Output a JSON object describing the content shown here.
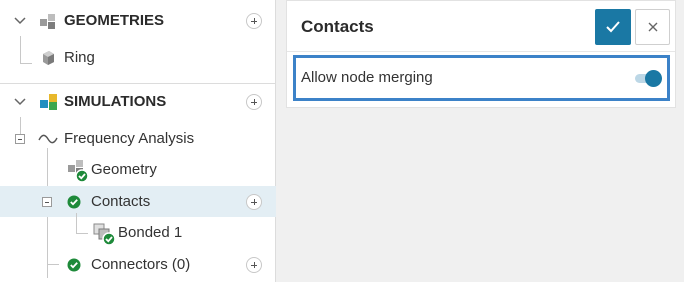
{
  "tree": {
    "geometries": {
      "label": "GEOMETRIES",
      "children": [
        {
          "label": "Ring"
        }
      ]
    },
    "simulations": {
      "label": "SIMULATIONS",
      "analysis": {
        "label": "Frequency Analysis",
        "items": [
          {
            "label": "Geometry",
            "status": "ok"
          },
          {
            "label": "Contacts",
            "status": "ok",
            "selected": true,
            "children": [
              {
                "label": "Bonded 1",
                "status": "ok"
              }
            ]
          },
          {
            "label": "Connectors (0)",
            "status": "ok"
          }
        ]
      }
    }
  },
  "dialog": {
    "title": "Contacts",
    "confirm_icon": "check-icon",
    "close_icon": "close-icon",
    "option": {
      "label": "Allow node merging",
      "enabled": true
    }
  },
  "colors": {
    "accent": "#1a78a4",
    "highlight_border": "#3c82c8",
    "selected_row": "#e3eef4",
    "status_ok": "#1e8a3a"
  }
}
